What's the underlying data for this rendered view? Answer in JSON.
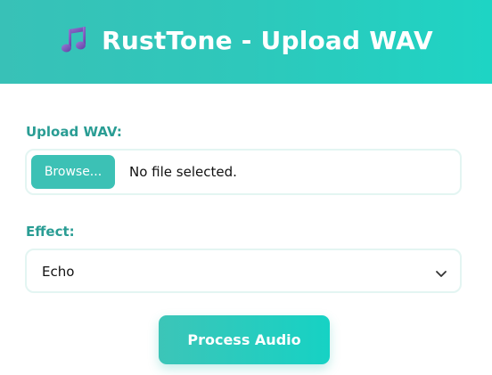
{
  "app": {
    "title": "RustTone - Upload WAV",
    "icon": "music-notes-icon"
  },
  "upload": {
    "label": "Upload WAV:",
    "browse_label": "Browse...",
    "status_text": "No file selected."
  },
  "effect": {
    "label": "Effect:",
    "selected": "Echo"
  },
  "actions": {
    "process_label": "Process Audio"
  },
  "colors": {
    "accent": "#2ec8bb",
    "label": "#2a9d94",
    "button": "#3cc1b5",
    "border": "#e3f5f2"
  }
}
